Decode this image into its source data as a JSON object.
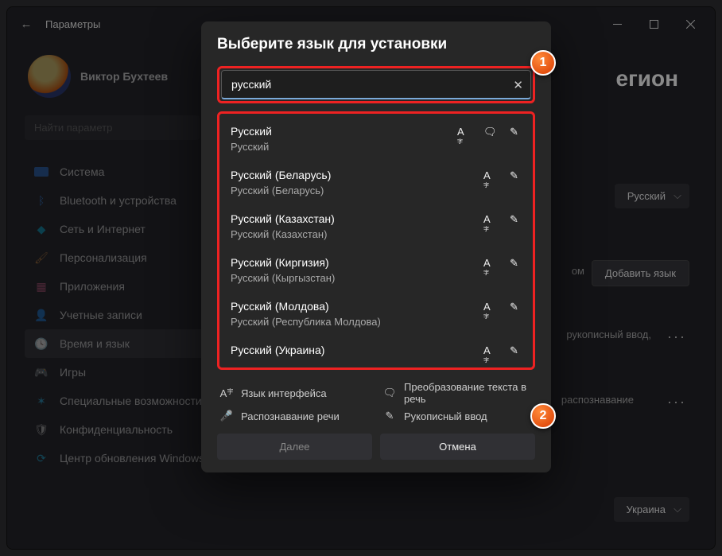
{
  "titlebar": {
    "title": "Параметры"
  },
  "profile": {
    "name": "Виктор Бухтеев"
  },
  "sidebar": {
    "search_placeholder": "Найти параметр",
    "items": [
      {
        "label": "Система"
      },
      {
        "label": "Bluetooth и устройства"
      },
      {
        "label": "Сеть и Интернет"
      },
      {
        "label": "Персонализация"
      },
      {
        "label": "Приложения"
      },
      {
        "label": "Учетные записи"
      },
      {
        "label": "Время и язык"
      },
      {
        "label": "Игры"
      },
      {
        "label": "Специальные возможности"
      },
      {
        "label": "Конфиденциальность"
      },
      {
        "label": "Центр обновления Windows"
      }
    ]
  },
  "main": {
    "page_title_fragment": "егион",
    "display_language": "Русский",
    "add_language_btn": "Добавить язык",
    "bg_text1": "ом",
    "bg_text2": "рукописный ввод,",
    "bg_text3": "распознавание",
    "region_dropdown": "Украина"
  },
  "modal": {
    "title": "Выберите язык для установки",
    "search_value": "русский",
    "results": [
      {
        "name": "Русский",
        "sub": "Русский",
        "feat": [
          "lang",
          "tts",
          "hand"
        ]
      },
      {
        "name": "Русский (Беларусь)",
        "sub": "Русский (Беларусь)",
        "feat": [
          "lang",
          "hand"
        ]
      },
      {
        "name": "Русский (Казахстан)",
        "sub": "Русский (Казахстан)",
        "feat": [
          "lang",
          "hand"
        ]
      },
      {
        "name": "Русский (Киргизия)",
        "sub": "Русский (Кыргызстан)",
        "feat": [
          "lang",
          "hand"
        ]
      },
      {
        "name": "Русский (Молдова)",
        "sub": "Русский (Республика Молдова)",
        "feat": [
          "lang",
          "hand"
        ]
      },
      {
        "name": "Русский (Украина)",
        "sub": "",
        "feat": [
          "lang",
          "hand"
        ]
      }
    ],
    "legend": {
      "interface": "Язык интерфейса",
      "tts": "Преобразование текста в речь",
      "speech": "Распознавание речи",
      "hand": "Рукописный ввод"
    },
    "next": "Далее",
    "cancel": "Отмена"
  },
  "callouts": {
    "one": "1",
    "two": "2"
  }
}
